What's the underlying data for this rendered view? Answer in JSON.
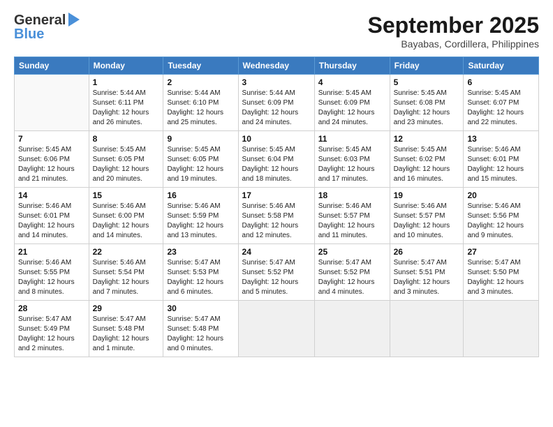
{
  "header": {
    "logo_line1": "General",
    "logo_line2": "Blue",
    "month_title": "September 2025",
    "location": "Bayabas, Cordillera, Philippines"
  },
  "weekdays": [
    "Sunday",
    "Monday",
    "Tuesday",
    "Wednesday",
    "Thursday",
    "Friday",
    "Saturday"
  ],
  "weeks": [
    [
      {
        "day": "",
        "info": ""
      },
      {
        "day": "1",
        "info": "Sunrise: 5:44 AM\nSunset: 6:11 PM\nDaylight: 12 hours\nand 26 minutes."
      },
      {
        "day": "2",
        "info": "Sunrise: 5:44 AM\nSunset: 6:10 PM\nDaylight: 12 hours\nand 25 minutes."
      },
      {
        "day": "3",
        "info": "Sunrise: 5:44 AM\nSunset: 6:09 PM\nDaylight: 12 hours\nand 24 minutes."
      },
      {
        "day": "4",
        "info": "Sunrise: 5:45 AM\nSunset: 6:09 PM\nDaylight: 12 hours\nand 24 minutes."
      },
      {
        "day": "5",
        "info": "Sunrise: 5:45 AM\nSunset: 6:08 PM\nDaylight: 12 hours\nand 23 minutes."
      },
      {
        "day": "6",
        "info": "Sunrise: 5:45 AM\nSunset: 6:07 PM\nDaylight: 12 hours\nand 22 minutes."
      }
    ],
    [
      {
        "day": "7",
        "info": "Sunrise: 5:45 AM\nSunset: 6:06 PM\nDaylight: 12 hours\nand 21 minutes."
      },
      {
        "day": "8",
        "info": "Sunrise: 5:45 AM\nSunset: 6:05 PM\nDaylight: 12 hours\nand 20 minutes."
      },
      {
        "day": "9",
        "info": "Sunrise: 5:45 AM\nSunset: 6:05 PM\nDaylight: 12 hours\nand 19 minutes."
      },
      {
        "day": "10",
        "info": "Sunrise: 5:45 AM\nSunset: 6:04 PM\nDaylight: 12 hours\nand 18 minutes."
      },
      {
        "day": "11",
        "info": "Sunrise: 5:45 AM\nSunset: 6:03 PM\nDaylight: 12 hours\nand 17 minutes."
      },
      {
        "day": "12",
        "info": "Sunrise: 5:45 AM\nSunset: 6:02 PM\nDaylight: 12 hours\nand 16 minutes."
      },
      {
        "day": "13",
        "info": "Sunrise: 5:46 AM\nSunset: 6:01 PM\nDaylight: 12 hours\nand 15 minutes."
      }
    ],
    [
      {
        "day": "14",
        "info": "Sunrise: 5:46 AM\nSunset: 6:01 PM\nDaylight: 12 hours\nand 14 minutes."
      },
      {
        "day": "15",
        "info": "Sunrise: 5:46 AM\nSunset: 6:00 PM\nDaylight: 12 hours\nand 14 minutes."
      },
      {
        "day": "16",
        "info": "Sunrise: 5:46 AM\nSunset: 5:59 PM\nDaylight: 12 hours\nand 13 minutes."
      },
      {
        "day": "17",
        "info": "Sunrise: 5:46 AM\nSunset: 5:58 PM\nDaylight: 12 hours\nand 12 minutes."
      },
      {
        "day": "18",
        "info": "Sunrise: 5:46 AM\nSunset: 5:57 PM\nDaylight: 12 hours\nand 11 minutes."
      },
      {
        "day": "19",
        "info": "Sunrise: 5:46 AM\nSunset: 5:57 PM\nDaylight: 12 hours\nand 10 minutes."
      },
      {
        "day": "20",
        "info": "Sunrise: 5:46 AM\nSunset: 5:56 PM\nDaylight: 12 hours\nand 9 minutes."
      }
    ],
    [
      {
        "day": "21",
        "info": "Sunrise: 5:46 AM\nSunset: 5:55 PM\nDaylight: 12 hours\nand 8 minutes."
      },
      {
        "day": "22",
        "info": "Sunrise: 5:46 AM\nSunset: 5:54 PM\nDaylight: 12 hours\nand 7 minutes."
      },
      {
        "day": "23",
        "info": "Sunrise: 5:47 AM\nSunset: 5:53 PM\nDaylight: 12 hours\nand 6 minutes."
      },
      {
        "day": "24",
        "info": "Sunrise: 5:47 AM\nSunset: 5:52 PM\nDaylight: 12 hours\nand 5 minutes."
      },
      {
        "day": "25",
        "info": "Sunrise: 5:47 AM\nSunset: 5:52 PM\nDaylight: 12 hours\nand 4 minutes."
      },
      {
        "day": "26",
        "info": "Sunrise: 5:47 AM\nSunset: 5:51 PM\nDaylight: 12 hours\nand 3 minutes."
      },
      {
        "day": "27",
        "info": "Sunrise: 5:47 AM\nSunset: 5:50 PM\nDaylight: 12 hours\nand 3 minutes."
      }
    ],
    [
      {
        "day": "28",
        "info": "Sunrise: 5:47 AM\nSunset: 5:49 PM\nDaylight: 12 hours\nand 2 minutes."
      },
      {
        "day": "29",
        "info": "Sunrise: 5:47 AM\nSunset: 5:48 PM\nDaylight: 12 hours\nand 1 minute."
      },
      {
        "day": "30",
        "info": "Sunrise: 5:47 AM\nSunset: 5:48 PM\nDaylight: 12 hours\nand 0 minutes."
      },
      {
        "day": "",
        "info": ""
      },
      {
        "day": "",
        "info": ""
      },
      {
        "day": "",
        "info": ""
      },
      {
        "day": "",
        "info": ""
      }
    ]
  ]
}
